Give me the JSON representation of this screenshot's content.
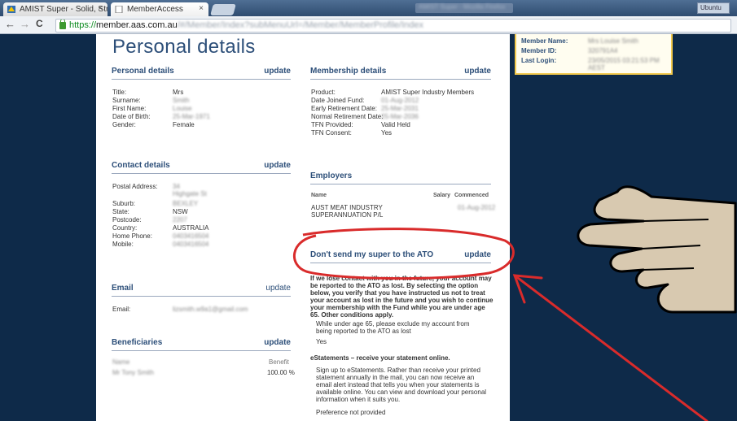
{
  "browser": {
    "tabs": [
      {
        "label": "AMIST Super - Solid, Stro",
        "close": "×"
      },
      {
        "label": "MemberAccess",
        "close": "×"
      }
    ],
    "blurred_title": "AMIST Super - Mozilla Firefox",
    "window_button": "Ubuntu",
    "nav": {
      "back": "←",
      "forward": "→",
      "reload": "C"
    },
    "url": {
      "scheme": "https://",
      "host": "member.aas.com.au",
      "path": "/#/Member/Index?subMenuUrl=/Member/MemberProfile/Index"
    }
  },
  "page": {
    "title": "Personal details",
    "personal": {
      "title": "Personal details",
      "update": "update",
      "rows": [
        {
          "k": "Title:",
          "v": "Mrs",
          "blur": false
        },
        {
          "k": "Surname:",
          "v": "Smith",
          "blur": true
        },
        {
          "k": "First Name:",
          "v": "Louise",
          "blur": true
        },
        {
          "k": "Date of Birth:",
          "v": "25-Mar-1971",
          "blur": true
        },
        {
          "k": "Gender:",
          "v": "Female",
          "blur": false
        }
      ]
    },
    "contact": {
      "title": "Contact details",
      "update": "update",
      "rows": [
        {
          "k": "Postal Address:",
          "v": "34",
          "v2": "Highgate St",
          "blur": true
        },
        {
          "k": "Suburb:",
          "v": "BEXLEY",
          "blur": true
        },
        {
          "k": "State:",
          "v": "NSW",
          "blur": false
        },
        {
          "k": "Postcode:",
          "v": "2207",
          "blur": true
        },
        {
          "k": "Country:",
          "v": "AUSTRALIA",
          "blur": false
        },
        {
          "k": "Home Phone:",
          "v": "0403416504",
          "blur": true
        },
        {
          "k": "Mobile:",
          "v": "0403416504",
          "blur": true
        }
      ]
    },
    "email": {
      "title": "Email",
      "update": "update",
      "k": "Email:",
      "v": "lizsmith.w9a1@gmail.com"
    },
    "beneficiaries": {
      "title": "Beneficiaries",
      "update": "update",
      "col_name": "Name",
      "col_benefit": "Benefit",
      "rows": [
        {
          "name": "Mr Tony Smith",
          "benefit": "100.00 %"
        }
      ]
    },
    "membership": {
      "title": "Membership details",
      "update": "update",
      "rows": [
        {
          "k": "Product:",
          "v": "AMIST Super Industry Members",
          "blur": false
        },
        {
          "k": "Date Joined Fund:",
          "v": "01-Aug-2012",
          "blur": true
        },
        {
          "k": "Early Retirement Date:",
          "v": "25-Mar-2031",
          "blur": true
        },
        {
          "k": "Normal Retirement Date:",
          "v": "25-Mar-2036",
          "blur": true
        },
        {
          "k": "TFN Provided:",
          "v": "Valid Held",
          "blur": false
        },
        {
          "k": "TFN Consent:",
          "v": "Yes",
          "blur": false
        }
      ]
    },
    "employers": {
      "title": "Employers",
      "col_name": "Name",
      "col_salary": "Salary",
      "col_commenced": "Commenced",
      "row_name_1": "AUST MEAT INDUSTRY",
      "row_name_2": "SUPERANNUATION P/L",
      "row_commenced": "01-Aug-2012"
    },
    "ato": {
      "title": "Don't send my super to the ATO",
      "update": "update",
      "desc": "If we lose contact with you in the future, your account may be reported to the ATO as lost. By selecting the option below, you verify that you have instructed us not to treat your account as lost in the future and you wish to continue your membership with the Fund while you are under age 65. Other conditions apply.",
      "option": "While under age 65, please exclude my account from being reported to the ATO as lost",
      "answer": "Yes"
    },
    "estatements": {
      "title": "eStatements – receive your statement online.",
      "desc": "Sign up to eStatements. Rather than receive your printed statement annually in the mail, you can now receive an email alert instead that tells you when your statements is available online. You can view and download your personal information when it suits you.",
      "preference": "Preference not provided"
    }
  },
  "member_box": {
    "rows": [
      {
        "k": "Member Name:",
        "v": "Mrs Louise Smith"
      },
      {
        "k": "Member ID:",
        "v": "320791A4"
      },
      {
        "k": "Last Login:",
        "v": "23/05/2015 03:21:53 PM AEST"
      }
    ]
  },
  "colors": {
    "accent": "#2d4f79",
    "highlight": "#d92b2b",
    "hand_fill": "#d8c9b0"
  }
}
